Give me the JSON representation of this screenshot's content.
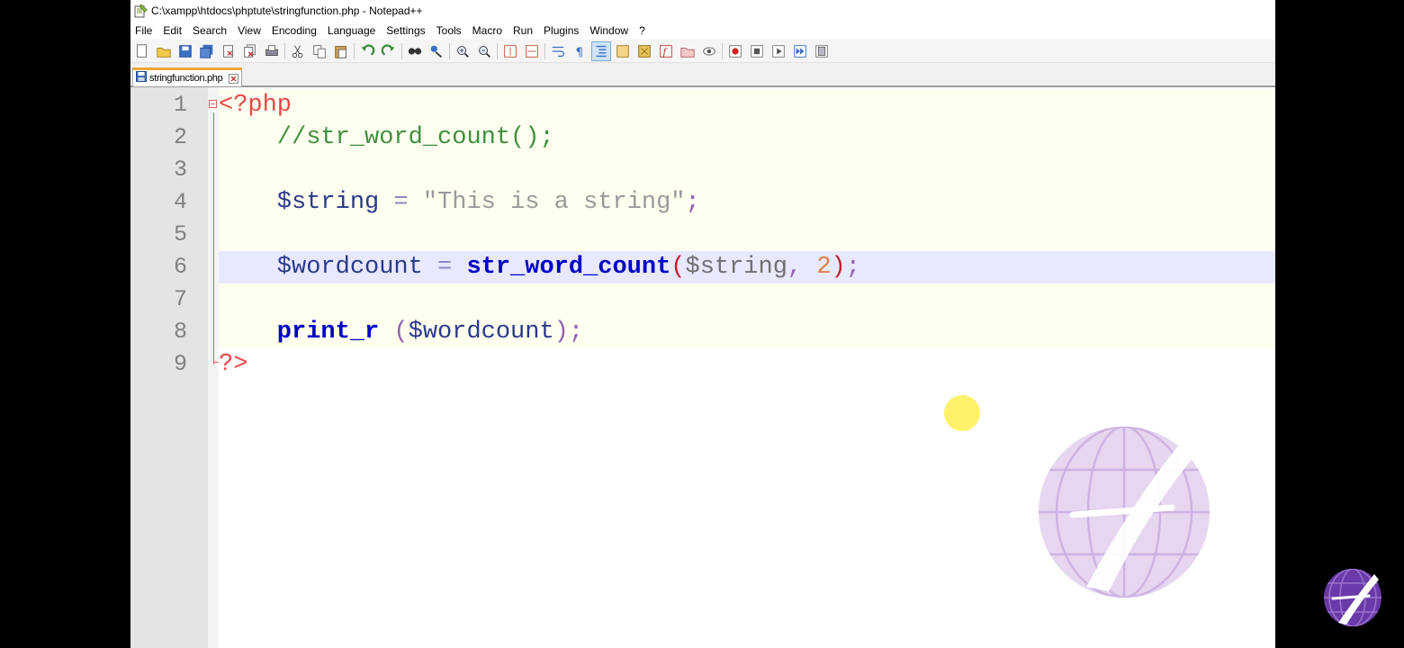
{
  "window": {
    "title": "C:\\xampp\\htdocs\\phptute\\stringfunction.php - Notepad++"
  },
  "menu": [
    "File",
    "Edit",
    "Search",
    "View",
    "Encoding",
    "Language",
    "Settings",
    "Tools",
    "Macro",
    "Run",
    "Plugins",
    "Window",
    "?"
  ],
  "toolbar": {
    "icons": [
      "new-file-icon",
      "open-file-icon",
      "save-icon",
      "save-all-icon",
      "close-icon",
      "close-all-icon",
      "print-icon",
      "cut-icon",
      "copy-icon",
      "paste-icon",
      "undo-icon",
      "redo-icon",
      "find-icon",
      "replace-icon",
      "zoom-in-icon",
      "zoom-out-icon",
      "sync-vertical-icon",
      "sync-horizontal-icon",
      "word-wrap-icon",
      "show-all-characters-icon",
      "indent-guide-icon",
      "user-defined-language-icon",
      "document-map-icon",
      "function-list-icon",
      "folder-workspace-icon",
      "monitoring-icon",
      "record-macro-icon",
      "stop-recording-icon",
      "play-macro-icon",
      "run-macro-multiple-icon",
      "save-macro-icon"
    ]
  },
  "tab": {
    "label": "stringfunction.php"
  },
  "editor": {
    "lines": [
      {
        "n": "1",
        "tokens": [
          {
            "t": "<?php",
            "c": "c-php"
          }
        ]
      },
      {
        "n": "2",
        "tokens": [
          {
            "t": "    //str_word_count();",
            "c": "c-comment"
          }
        ]
      },
      {
        "n": "3",
        "tokens": []
      },
      {
        "n": "4",
        "tokens": [
          {
            "t": "    $string",
            "c": "c-var"
          },
          {
            "t": " = ",
            "c": "c-op"
          },
          {
            "t": "\"This is a string\"",
            "c": "c-str"
          },
          {
            "t": ";",
            "c": "c-punct"
          }
        ]
      },
      {
        "n": "5",
        "tokens": []
      },
      {
        "n": "6",
        "tokens": [
          {
            "t": "    $wordcount",
            "c": "c-var"
          },
          {
            "t": " = ",
            "c": "c-op"
          },
          {
            "t": "str_word_count",
            "c": "c-func"
          },
          {
            "t": "(",
            "c": "c-paren"
          },
          {
            "t": "$string",
            "c": "c-plain"
          },
          {
            "t": ", ",
            "c": "c-punct"
          },
          {
            "t": "2",
            "c": "c-num"
          },
          {
            "t": ")",
            "c": "c-paren"
          },
          {
            "t": ";",
            "c": "c-punct"
          }
        ]
      },
      {
        "n": "7",
        "tokens": []
      },
      {
        "n": "8",
        "tokens": [
          {
            "t": "    print_r",
            "c": "c-func"
          },
          {
            "t": " (",
            "c": "c-punct"
          },
          {
            "t": "$wordcount",
            "c": "c-var"
          },
          {
            "t": ");",
            "c": "c-punct"
          }
        ]
      },
      {
        "n": "9",
        "tokens": [
          {
            "t": "?>",
            "c": "c-php"
          }
        ]
      }
    ],
    "current_line": 6,
    "tinted_lines": [
      1,
      2,
      3,
      4,
      5,
      7,
      8
    ]
  },
  "colors": {
    "tab_accent": "#f3a434",
    "current_line": "#e8e8ff",
    "php_tag": "#e84848",
    "keyword": "#0000c8"
  }
}
